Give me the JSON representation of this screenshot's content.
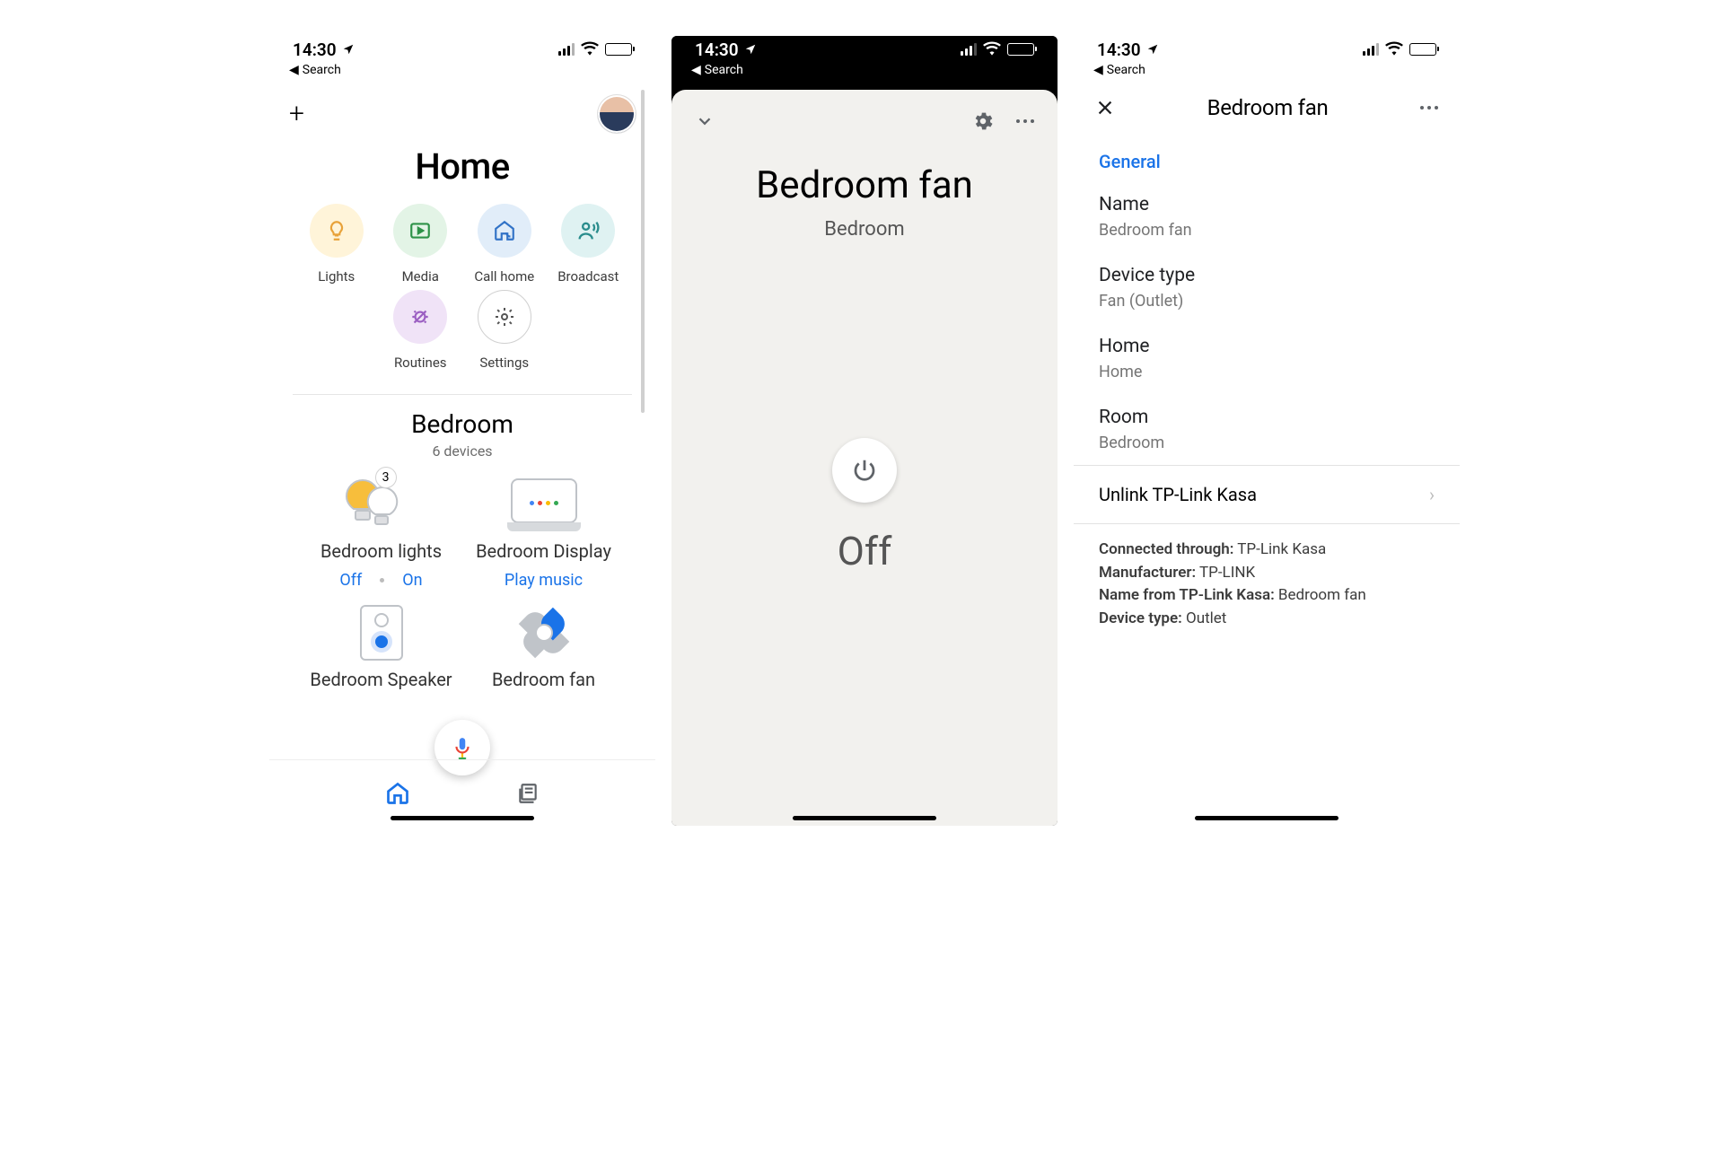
{
  "status": {
    "time": "14:30",
    "breadcrumb": "Search"
  },
  "screen1": {
    "title": "Home",
    "actions": [
      {
        "label": "Lights",
        "color": "c-yellow"
      },
      {
        "label": "Media",
        "color": "c-green"
      },
      {
        "label": "Call home",
        "color": "c-blue"
      },
      {
        "label": "Broadcast",
        "color": "c-teal"
      },
      {
        "label": "Routines",
        "color": "c-purple"
      },
      {
        "label": "Settings",
        "color": "c-white"
      }
    ],
    "room": {
      "name": "Bedroom",
      "sub": "6 devices"
    },
    "devices": {
      "lights": {
        "name": "Bedroom lights",
        "badge": "3",
        "off": "Off",
        "on": "On"
      },
      "display": {
        "name": "Bedroom Display",
        "action": "Play music"
      },
      "speaker": {
        "name": "Bedroom Speaker"
      },
      "fan": {
        "name": "Bedroom fan"
      }
    }
  },
  "screen2": {
    "title": "Bedroom fan",
    "sub": "Bedroom",
    "state": "Off"
  },
  "screen3": {
    "title": "Bedroom fan",
    "section": "General",
    "name": {
      "label": "Name",
      "value": "Bedroom fan"
    },
    "type": {
      "label": "Device type",
      "value": "Fan (Outlet)"
    },
    "home": {
      "label": "Home",
      "value": "Home"
    },
    "room": {
      "label": "Room",
      "value": "Bedroom"
    },
    "unlink": "Unlink TP-Link Kasa",
    "meta": {
      "connected": {
        "k": "Connected through:",
        "v": " TP-Link Kasa"
      },
      "manufacturer": {
        "k": "Manufacturer:",
        "v": " TP-LINK"
      },
      "namefrom": {
        "k": "Name from TP-Link Kasa:",
        "v": " Bedroom fan"
      },
      "devtype": {
        "k": "Device type:",
        "v": " Outlet"
      }
    }
  }
}
